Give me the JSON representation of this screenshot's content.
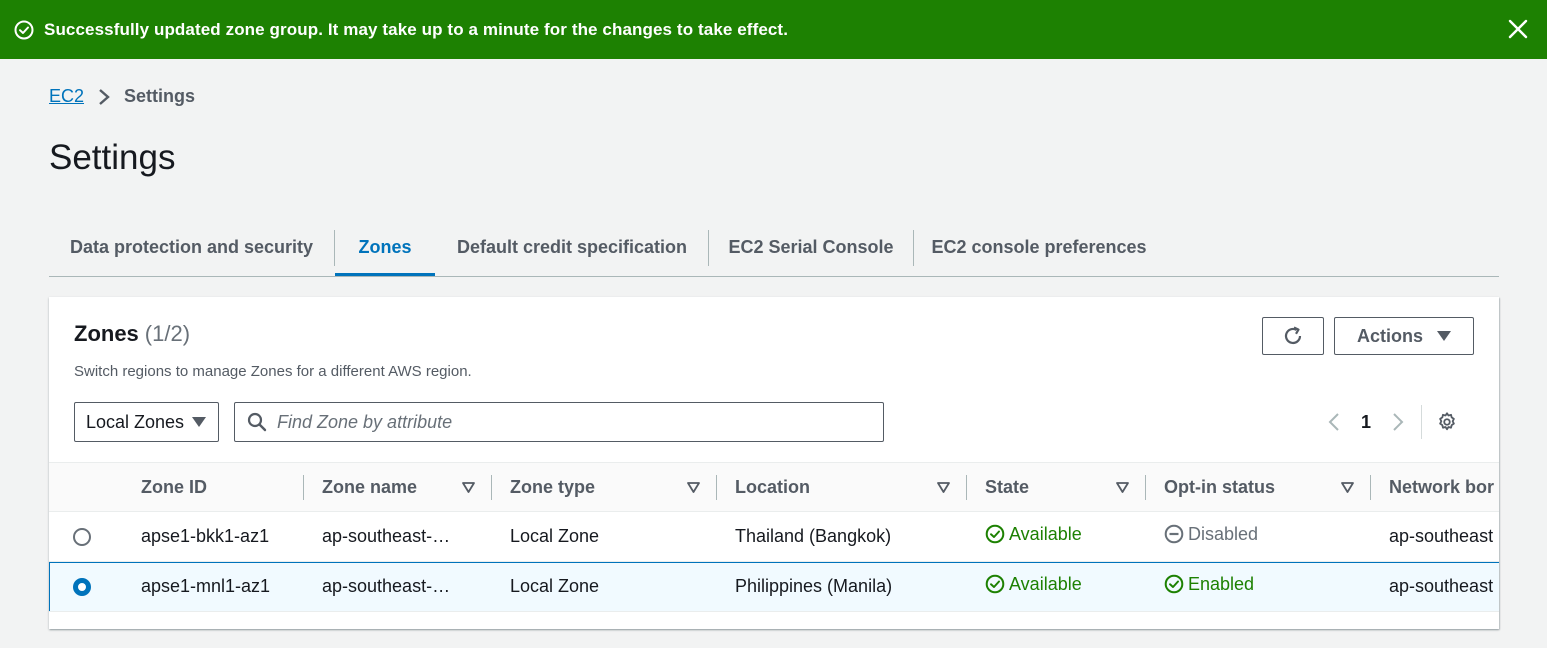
{
  "flash": {
    "message": "Successfully updated zone group. It may take up to a minute for the changes to take effect."
  },
  "breadcrumb": {
    "root": "EC2",
    "current": "Settings"
  },
  "page": {
    "title": "Settings"
  },
  "tabs": [
    {
      "label": "Data protection and security",
      "active": false
    },
    {
      "label": "Zones",
      "active": true
    },
    {
      "label": "Default credit specification",
      "active": false
    },
    {
      "label": "EC2 Serial Console",
      "active": false
    },
    {
      "label": "EC2 console preferences",
      "active": false
    }
  ],
  "panel": {
    "title": "Zones",
    "count": "(1/2)",
    "description": "Switch regions to manage Zones for a different AWS region.",
    "actions_label": "Actions",
    "zone_filter": "Local Zones",
    "search_placeholder": "Find Zone by attribute",
    "page_number": "1"
  },
  "table": {
    "columns": [
      "Zone ID",
      "Zone name",
      "Zone type",
      "Location",
      "State",
      "Opt-in status",
      "Network bor"
    ],
    "rows": [
      {
        "selected": false,
        "zone_id": "apse1-bkk1-az1",
        "zone_name": "ap-southeast-…",
        "zone_type": "Local Zone",
        "location": "Thailand (Bangkok)",
        "state": "Available",
        "opt_in": "Disabled",
        "network": "ap-southeast"
      },
      {
        "selected": true,
        "zone_id": "apse1-mnl1-az1",
        "zone_name": "ap-southeast-…",
        "zone_type": "Local Zone",
        "location": "Philippines (Manila)",
        "state": "Available",
        "opt_in": "Enabled",
        "network": "ap-southeast"
      }
    ]
  },
  "colors": {
    "success": "#1d8102",
    "link": "#0073bb",
    "text": "#16191f",
    "muted": "#545b64",
    "background": "#f2f3f3"
  }
}
